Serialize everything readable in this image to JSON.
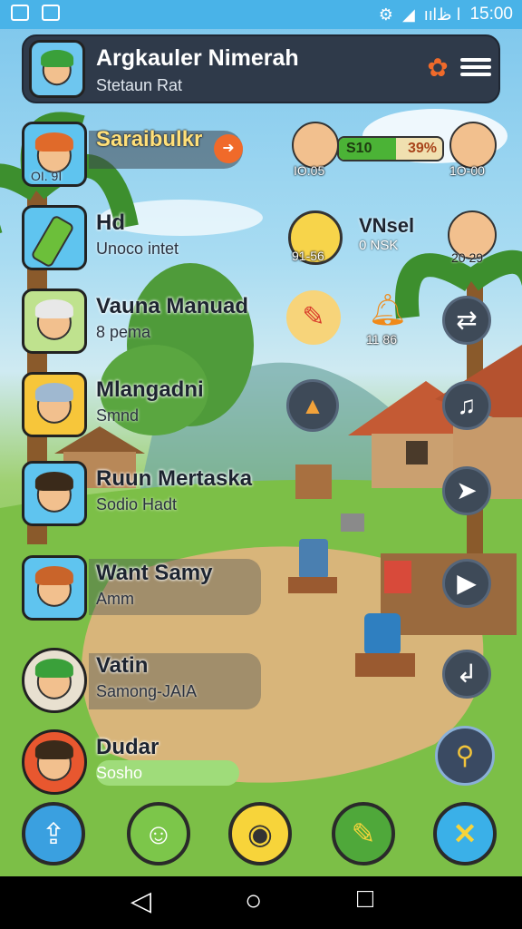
{
  "status_bar": {
    "icons_left": [
      "notification-icon",
      "image-icon"
    ],
    "signal_text": "ıılا ظ",
    "time": "15:00"
  },
  "header": {
    "title": "Argkauler Nimerah",
    "subtitle": "Stetaun Rat",
    "icons": [
      "flower-gear-icon",
      "menu-icon"
    ]
  },
  "players": [
    {
      "name": "Saraibulkr",
      "sub": "OI. 9I"
    },
    {
      "name": "Hd",
      "sub": "Unoco intet"
    },
    {
      "name": "Vauna Manuad",
      "sub": "8 pema"
    },
    {
      "name": "Mlangadni",
      "sub": "Smnd"
    },
    {
      "name": "Ruun Mertaska",
      "sub": "Sodio Hadt"
    },
    {
      "name": "Want Samy",
      "sub": "Amm"
    },
    {
      "name": "Vatin",
      "sub": "Samong-JAIA"
    },
    {
      "name": "Dudar",
      "sub": "Sosho"
    }
  ],
  "resource": {
    "value": "S10",
    "percent": "39%",
    "progress_percent": 55
  },
  "scores": {
    "left_1": "IO.05",
    "right_1": "1O-00",
    "left_2": "91-56",
    "right_2": "20 29",
    "center": "VNsel",
    "center_sub": "0  NSK",
    "bell": "11 86"
  },
  "right_buttons": [
    "swap-icon",
    "music-note-icon",
    "pin-icon",
    "play-arrow-icon",
    "back-arrow-icon",
    "search-key-icon"
  ],
  "bottom_buttons": [
    "share-icon",
    "smiley-icon",
    "bird-icon",
    "pencil-icon",
    "close-icon"
  ],
  "nav": {
    "back": "◁",
    "home": "○",
    "recent": "□"
  },
  "colors": {
    "accent": "#f06a2a",
    "panel": "#2f3a4a",
    "sky": "#7cc6ec",
    "grass": "#7bbf4a",
    "progress": "#4bb336"
  }
}
